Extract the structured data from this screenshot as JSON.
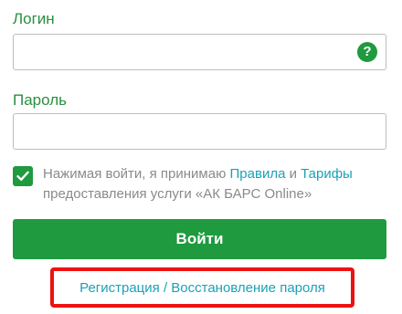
{
  "login": {
    "label": "Логин",
    "value": "",
    "placeholder": "",
    "help_icon": "question-circle-icon",
    "help_glyph": "?"
  },
  "password": {
    "label": "Пароль",
    "value": "",
    "placeholder": ""
  },
  "consent": {
    "checked": true,
    "text_before": "Нажимая войти, я принимаю ",
    "rules_link": "Правила",
    "text_and": " и ",
    "tariffs_link": "Тарифы",
    "text_after": " предоставления услуги «АК БАРС Online»"
  },
  "submit": {
    "label": "Войти"
  },
  "register": {
    "link_text": "Регистрация / Восстановление пароля",
    "highlight_color": "#ee1111"
  },
  "colors": {
    "brand_green": "#1f9a3f",
    "label_green": "#2a8f3f",
    "link_teal": "#1aa2b6",
    "muted_text": "#8a8a8a",
    "border_gray": "#bdbdbd"
  }
}
